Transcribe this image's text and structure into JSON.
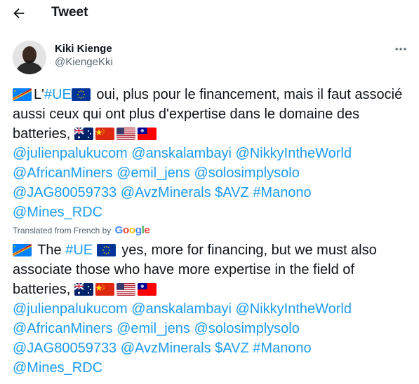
{
  "header": {
    "title": "Tweet",
    "back_icon": "arrow-left-icon"
  },
  "author": {
    "name": "Kiki Kienge",
    "handle": "@KiengeKki"
  },
  "tweet": {
    "original": {
      "prefix": "L'",
      "ue_tag": "#UE",
      "sentence": " oui, plus pour le financement, mais il faut associé aussi ceux qui ont plus d'expertise dans le domaine des batteries,",
      "mentions": [
        "@julienpalukucom",
        "@anskalambayi",
        "@NikkyIntheWorld",
        "@AfricanMiners",
        "@emil_jens",
        "@solosimplysolo",
        "@JAG80059733",
        "@AvzMinerals"
      ],
      "cashtag": "$AVZ",
      "hashtag": "#Manono",
      "last_mention": "@Mines_RDC"
    },
    "translated_from": "Translated from French by",
    "translator_brand": "Google",
    "translation": {
      "prefix": " The ",
      "ue_tag": "#UE",
      "sentence": " yes, more for financing, but we must also associate those who have more expertise in the field of batteries,",
      "mentions": [
        "@julienpalukucom",
        "@anskalambayi",
        "@NikkyIntheWorld",
        "@AfricanMiners",
        "@emil_jens",
        "@solosimplysolo",
        "@JAG80059733",
        "@AvzMinerals"
      ],
      "cashtag": "$AVZ",
      "hashtag": "#Manono",
      "last_mention": "@Mines_RDC"
    },
    "flags": [
      "drc-flag",
      "eu-flag",
      "australia-flag",
      "china-flag",
      "usa-flag",
      "taiwan-flag"
    ]
  },
  "colors": {
    "link": "#1d9bf0",
    "text": "#0f1419",
    "secondary": "#536471"
  }
}
